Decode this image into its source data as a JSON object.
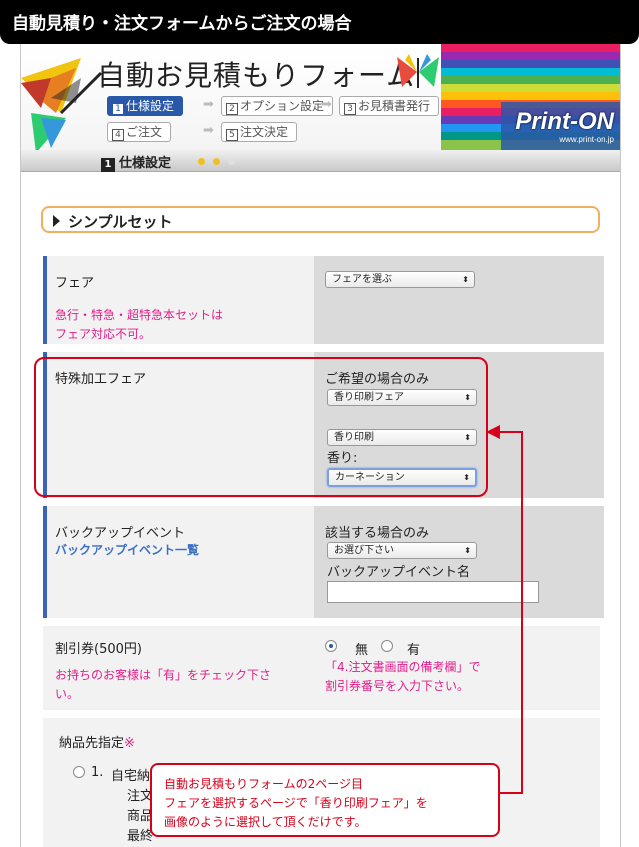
{
  "banner_title": "自動見積り・注文フォームからご注文の場合",
  "header": {
    "title": "自動お見積もりフォーム",
    "brand": "Print-ON",
    "brand_url": "www.print-on.jp",
    "steps": [
      {
        "num": "1",
        "label": "仕様設定",
        "active": true
      },
      {
        "num": "2",
        "label": "オプション設定",
        "active": false
      },
      {
        "num": "3",
        "label": "お見積書発行",
        "active": false
      },
      {
        "num": "4",
        "label": "ご注文",
        "active": false
      },
      {
        "num": "5",
        "label": "注文決定",
        "active": false
      }
    ]
  },
  "stepbar": {
    "num": "1",
    "label": "仕様設定"
  },
  "section": {
    "title": "シンプルセット"
  },
  "fair": {
    "label": "フェア",
    "note_line1": "急行・特急・超特急本セットは",
    "note_line2": "フェア対応不可。",
    "select_value": "フェアを選ぶ"
  },
  "special": {
    "label": "特殊加工フェア",
    "right_heading": "ご希望の場合のみ",
    "select1_value": "香り印刷フェア",
    "select2_value": "香り印刷",
    "scent_label": "香り:",
    "scent_value": "カーネーション"
  },
  "backup": {
    "label": "バックアップイベント",
    "link": "バックアップイベント一覧",
    "right_heading": "該当する場合のみ",
    "select_value": "お選び下さい",
    "name_label": "バックアップイベント名"
  },
  "coupon": {
    "label": "割引券(500円)",
    "note_line1": "お持ちのお客様は「有」をチェック下さ",
    "note_line2": "い。",
    "opt_none": "無",
    "opt_yes": "有",
    "right_note1": "「4.注文書画面の備考欄」で",
    "right_note2": "割引券番号を入力下さい。"
  },
  "delivery": {
    "label": "納品先指定",
    "required_mark": "※",
    "option_num": "1.",
    "option_text": "自宅納",
    "sub1": "注文",
    "sub2": "商品",
    "sub3": "最終"
  },
  "callout": {
    "line1": "自動お見積もりフォームの2ページ目",
    "line2": "フェアを選択するページで「香り印刷フェア」を",
    "line3": "画像のように選択して頂くだけです。"
  },
  "colors": {
    "accent": "#3b63b6",
    "highlight": "#d7001a",
    "note": "#e0208a",
    "active_step": "#2a58a8"
  }
}
